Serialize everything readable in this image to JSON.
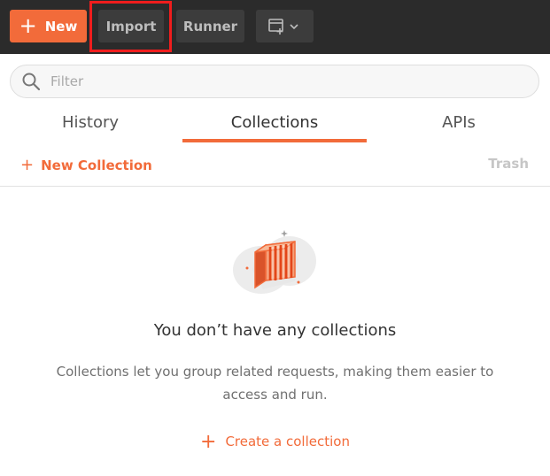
{
  "toolbar": {
    "new_label": "New",
    "import_label": "Import",
    "runner_label": "Runner"
  },
  "filter": {
    "placeholder": "Filter"
  },
  "tabs": [
    {
      "label": "History",
      "active": false
    },
    {
      "label": "Collections",
      "active": true
    },
    {
      "label": "APIs",
      "active": false
    }
  ],
  "actions": {
    "new_collection": "New Collection",
    "trash": "Trash"
  },
  "empty_state": {
    "title": "You don’t have any collections",
    "description": "Collections let you group related requests, making them easier to access and run.",
    "create_link": "Create a collection"
  },
  "colors": {
    "accent": "#f26b3a",
    "toolbar_bg": "#2b2b2b",
    "highlight": "#f01d1d"
  },
  "icons": [
    "plus-icon",
    "window-icon",
    "chevron-down-icon",
    "search-icon",
    "collections-illustration"
  ]
}
